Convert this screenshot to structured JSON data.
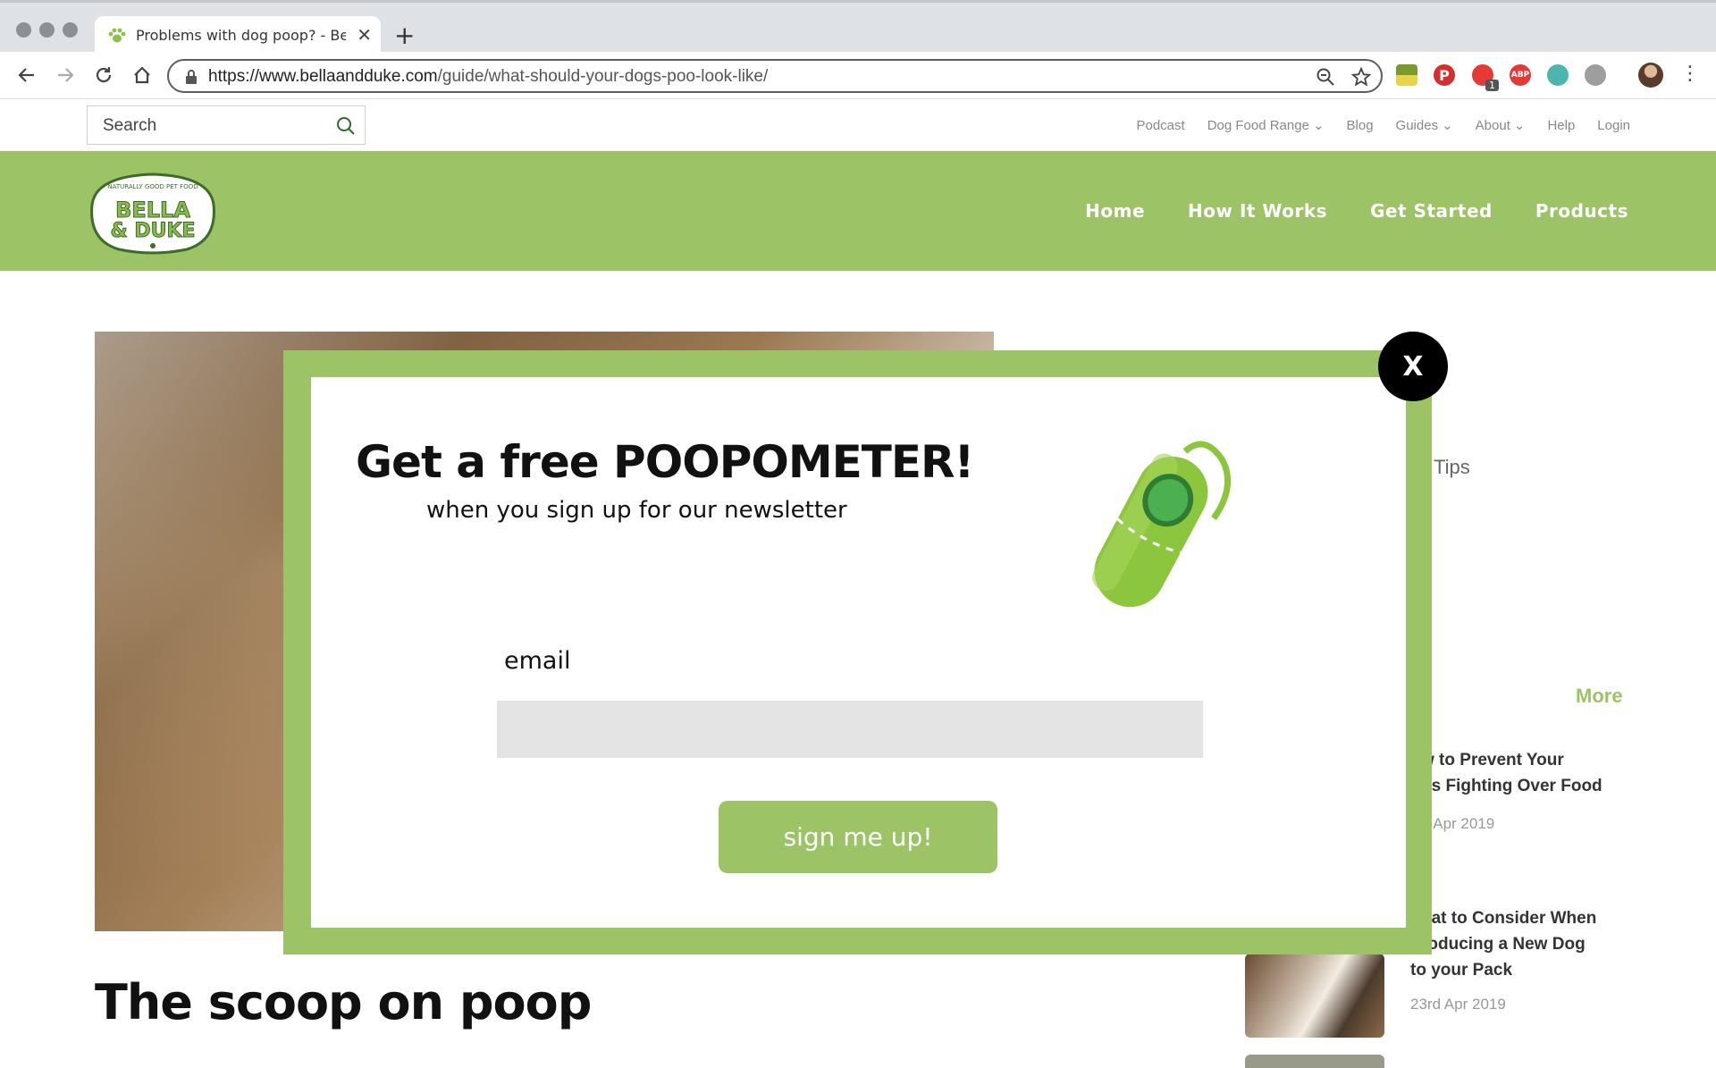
{
  "browser": {
    "tab_title": "Problems with dog poop? - Bel",
    "new_tab_label": "+",
    "url_host": "https://www.bellaandduke.com",
    "url_path": "/guide/what-should-your-dogs-poo-look-like/",
    "extension_badge": "1",
    "abp_label": "ABP"
  },
  "site": {
    "search_placeholder": "Search",
    "utility_nav": [
      "Podcast",
      "Dog Food Range",
      "Blog",
      "Guides",
      "About",
      "Help",
      "Login"
    ],
    "logo_line1": "BELLA",
    "logo_line2": "& DUKE",
    "logo_tagline": "NATURALLY GOOD PET FOOD",
    "main_nav": [
      "Home",
      "How It Works",
      "Get Started",
      "Products"
    ],
    "brand_color": "#9cc467"
  },
  "article": {
    "title": "The scoop on poop"
  },
  "sidebar": {
    "tips_label": "g Tips",
    "more_label": "More",
    "posts": [
      {
        "title_lines": [
          "w to Prevent Your",
          "gs Fighting Over Food"
        ],
        "date": "h Apr 2019"
      },
      {
        "title_lines": [
          "hat to Consider When",
          "roducing a New Dog",
          "to your Pack"
        ],
        "date": "23rd Apr 2019"
      }
    ]
  },
  "modal": {
    "title": "Get a free POOPOMETER!",
    "subtitle": "when you sign up for our newsletter",
    "email_label": "email",
    "email_value": "",
    "button_label": "sign  me up!",
    "close_label": "X"
  }
}
